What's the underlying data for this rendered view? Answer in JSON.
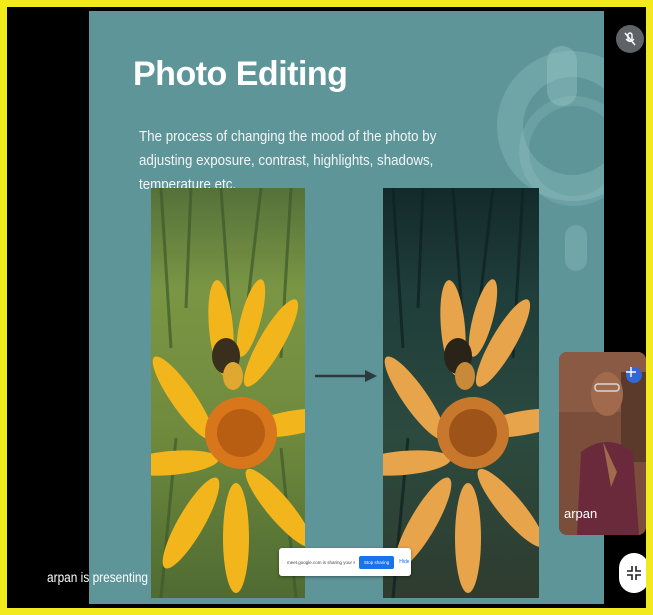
{
  "slide": {
    "title": "Photo Editing",
    "description": "The process of changing the mood of the photo by adjusting exposure, contrast, highlights, shadows, temperature etc."
  },
  "share_bar": {
    "text": "meet.google.com is sharing your screen.",
    "stop_label": "Stop sharing",
    "hide_label": "Hide"
  },
  "presenter": {
    "status": "arpan is presenting",
    "tile_name": "arpan"
  },
  "icons": {
    "mic": "mic-off-icon",
    "pin": "pin-move-icon",
    "collapse": "collapse-icon"
  },
  "colors": {
    "border": "#f2ea1c",
    "slide_bg": "#5e9599",
    "accent": "#1a73e8"
  }
}
